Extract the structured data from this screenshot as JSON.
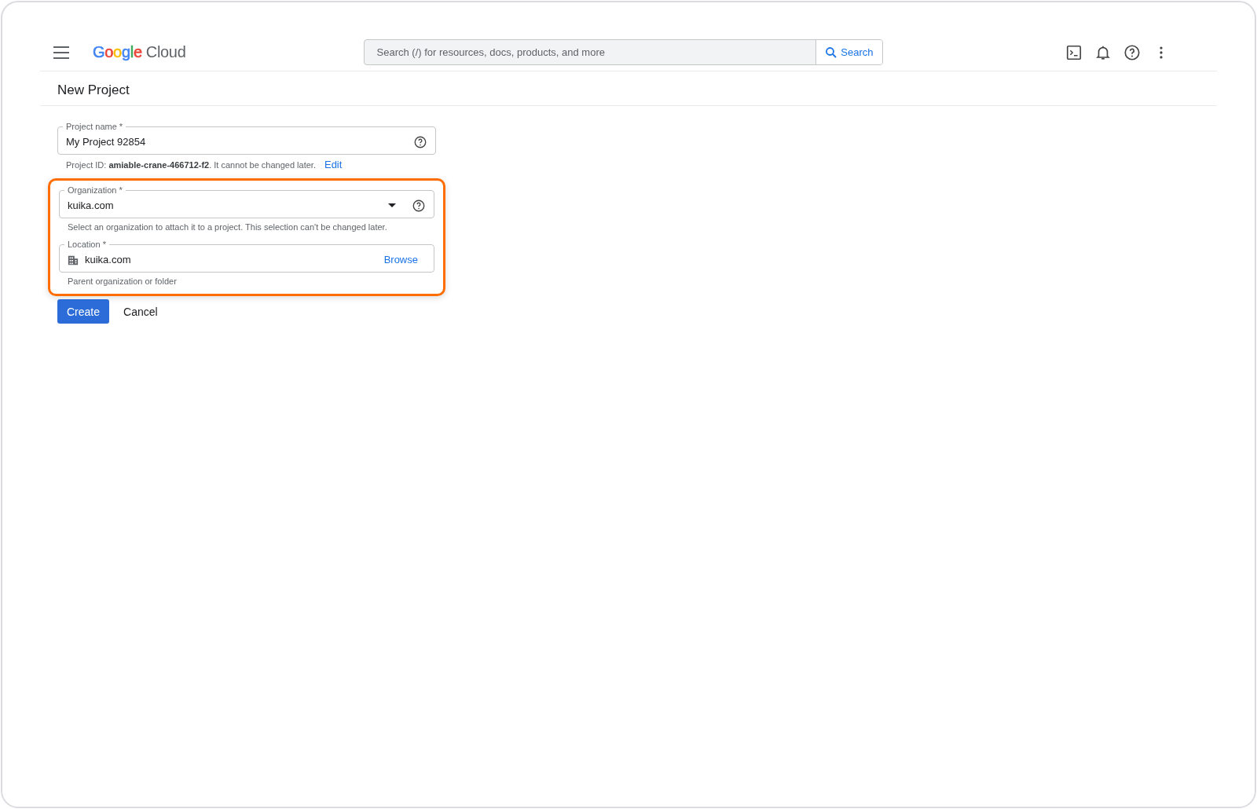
{
  "header": {
    "logo": {
      "letters": [
        {
          "text": "G",
          "color": "#4285f4"
        },
        {
          "text": "o",
          "color": "#ea4335"
        },
        {
          "text": "o",
          "color": "#fbbc04"
        },
        {
          "text": "g",
          "color": "#4285f4"
        },
        {
          "text": "l",
          "color": "#34a853"
        },
        {
          "text": "e",
          "color": "#ea4335"
        }
      ],
      "product": "Cloud"
    },
    "search": {
      "placeholder": "Search (/) for resources, docs, products, and more",
      "button": "Search"
    }
  },
  "page_title": "New Project",
  "form": {
    "project_name": {
      "label": "Project name *",
      "value": "My Project 92854"
    },
    "project_id": {
      "text": "Project ID: **amiable-crane-466712-f2**. It cannot be changed later.",
      "link": "Edit"
    },
    "organization": {
      "label": "Organization *",
      "value": "kuika.com",
      "helper": "Select an organization to attach it to a project. This selection can't be changed later."
    },
    "location": {
      "label": "Location *",
      "value": "kuika.com",
      "action": "Browse",
      "helper": "Parent organization or folder"
    },
    "buttons": {
      "primary": "Create",
      "secondary": "Cancel"
    }
  }
}
